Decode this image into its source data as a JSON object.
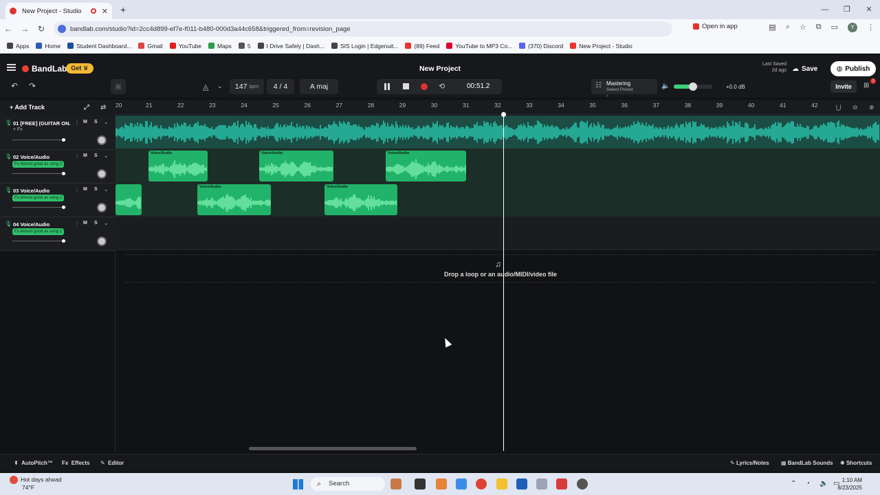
{
  "browser": {
    "tab_title": "New Project - Studio",
    "new_tab": "+",
    "url": "bandlab.com/studio?id=2cc4d899-ef7e-f011-b480-000d3a44c658&triggered_from=revision_page",
    "open_in_app": "Open in app",
    "profile_initial": "Y",
    "bookmarks": [
      "Apps",
      "Home",
      "Student Dashboard...",
      "Gmail",
      "YouTube",
      "Maps",
      "5",
      "I Drive Safely | Dash...",
      "SIS Login | Edgenuit...",
      "(89) Feed",
      "YouTube to MP3 Co...",
      "(370) Discord",
      "New Project - Studio"
    ]
  },
  "app": {
    "brand": "BandLab",
    "get_label": "Get",
    "project_title": "New Project",
    "last_saved_label": "Last Saved",
    "last_saved_value": "2d ago",
    "save_label": "Save",
    "publish_label": "Publish",
    "invite_label": "Invite",
    "gift_badge": "1"
  },
  "transport": {
    "bpm_value": "147",
    "bpm_unit": "bpm",
    "time_signature": "4 / 4",
    "key": "A maj",
    "time": "00:51.2",
    "mastering_label": "Mastering",
    "mastering_preset": "Select Preset",
    "master_gain": "+0.0 dB",
    "master_volume_fraction": 0.5
  },
  "tracks_panel": {
    "add_track_label": "Add Track",
    "ruler_bars": [
      "20",
      "21",
      "22",
      "23",
      "24",
      "25",
      "26",
      "27",
      "28",
      "29",
      "30",
      "31",
      "32",
      "33",
      "34",
      "35",
      "36",
      "37",
      "38",
      "39",
      "40",
      "41",
      "42"
    ],
    "tracks": [
      {
        "number": "01",
        "name": "[FREE] (GUITAR ON...",
        "fx": "+ Fx",
        "fx_is_preset": false
      },
      {
        "number": "02",
        "name": "Voice/Audio",
        "fx": "Fx Almost good as song 2",
        "fx_is_preset": true
      },
      {
        "number": "03",
        "name": "Voice/Audio",
        "fx": "Fx Almost good as song 2",
        "fx_is_preset": true
      },
      {
        "number": "04",
        "name": "Voice/Audio",
        "fx": "Fx Almost good as song 2",
        "fx_is_preset": true
      }
    ],
    "mute_label": "M",
    "solo_label": "S",
    "clip_name": "Voice/Audio"
  },
  "dropzone": {
    "text": "Drop a loop or an audio/MIDI/video file"
  },
  "bottom_bar": {
    "autopitch": "AutoPitch™",
    "effects": "Effects",
    "editor": "Editor",
    "lyrics": "Lyrics/Notes",
    "sounds": "BandLab Sounds",
    "shortcuts": "Shortcuts"
  },
  "taskbar": {
    "weather_title": "Hot days ahead",
    "weather_temp": "74°F",
    "search_label": "Search",
    "time": "1:10 AM",
    "date": "8/23/2025"
  }
}
